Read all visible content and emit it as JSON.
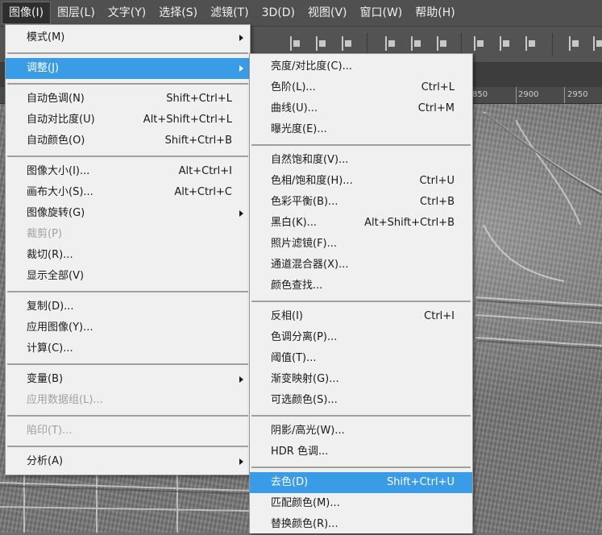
{
  "menubar": {
    "items": [
      "图像(I)",
      "图层(L)",
      "文字(Y)",
      "选择(S)",
      "滤镜(T)",
      "3D(D)",
      "视图(V)",
      "窗口(W)",
      "帮助(H)"
    ]
  },
  "ruler": {
    "ticks": [
      "850",
      "2900",
      "2950"
    ]
  },
  "image_menu": {
    "items": [
      {
        "label": "模式(M)",
        "shortcut": "",
        "submenu": true
      },
      {
        "label": "调整(J)",
        "shortcut": "",
        "submenu": true
      },
      {
        "label": "自动色调(N)",
        "shortcut": "Shift+Ctrl+L"
      },
      {
        "label": "自动对比度(U)",
        "shortcut": "Alt+Shift+Ctrl+L"
      },
      {
        "label": "自动颜色(O)",
        "shortcut": "Shift+Ctrl+B"
      },
      {
        "label": "图像大小(I)...",
        "shortcut": "Alt+Ctrl+I"
      },
      {
        "label": "画布大小(S)...",
        "shortcut": "Alt+Ctrl+C"
      },
      {
        "label": "图像旋转(G)",
        "shortcut": "",
        "submenu": true
      },
      {
        "label": "裁剪(P)",
        "shortcut": "",
        "disabled": true
      },
      {
        "label": "裁切(R)...",
        "shortcut": ""
      },
      {
        "label": "显示全部(V)",
        "shortcut": ""
      },
      {
        "label": "复制(D)...",
        "shortcut": ""
      },
      {
        "label": "应用图像(Y)...",
        "shortcut": ""
      },
      {
        "label": "计算(C)...",
        "shortcut": ""
      },
      {
        "label": "变量(B)",
        "shortcut": "",
        "submenu": true
      },
      {
        "label": "应用数据组(L)...",
        "shortcut": "",
        "disabled": true
      },
      {
        "label": "陷印(T)...",
        "shortcut": "",
        "disabled": true
      },
      {
        "label": "分析(A)",
        "shortcut": "",
        "submenu": true
      }
    ]
  },
  "adjust_menu": {
    "items": [
      {
        "label": "亮度/对比度(C)...",
        "shortcut": ""
      },
      {
        "label": "色阶(L)...",
        "shortcut": "Ctrl+L"
      },
      {
        "label": "曲线(U)...",
        "shortcut": "Ctrl+M"
      },
      {
        "label": "曝光度(E)...",
        "shortcut": ""
      },
      {
        "label": "自然饱和度(V)...",
        "shortcut": ""
      },
      {
        "label": "色相/饱和度(H)...",
        "shortcut": "Ctrl+U"
      },
      {
        "label": "色彩平衡(B)...",
        "shortcut": "Ctrl+B"
      },
      {
        "label": "黑白(K)...",
        "shortcut": "Alt+Shift+Ctrl+B"
      },
      {
        "label": "照片滤镜(F)...",
        "shortcut": ""
      },
      {
        "label": "通道混合器(X)...",
        "shortcut": ""
      },
      {
        "label": "颜色查找...",
        "shortcut": ""
      },
      {
        "label": "反相(I)",
        "shortcut": "Ctrl+I"
      },
      {
        "label": "色调分离(P)...",
        "shortcut": ""
      },
      {
        "label": "阈值(T)...",
        "shortcut": ""
      },
      {
        "label": "渐变映射(G)...",
        "shortcut": ""
      },
      {
        "label": "可选颜色(S)...",
        "shortcut": ""
      },
      {
        "label": "阴影/高光(W)...",
        "shortcut": ""
      },
      {
        "label": "HDR 色调...",
        "shortcut": ""
      },
      {
        "label": "去色(D)",
        "shortcut": "Shift+Ctrl+U"
      },
      {
        "label": "匹配颜色(M)...",
        "shortcut": ""
      },
      {
        "label": "替换颜色(R)...",
        "shortcut": ""
      }
    ]
  },
  "colors": {
    "highlight": "#3a9be6",
    "menu_bg": "#f0f0f0",
    "menubar_bg": "#505050"
  }
}
